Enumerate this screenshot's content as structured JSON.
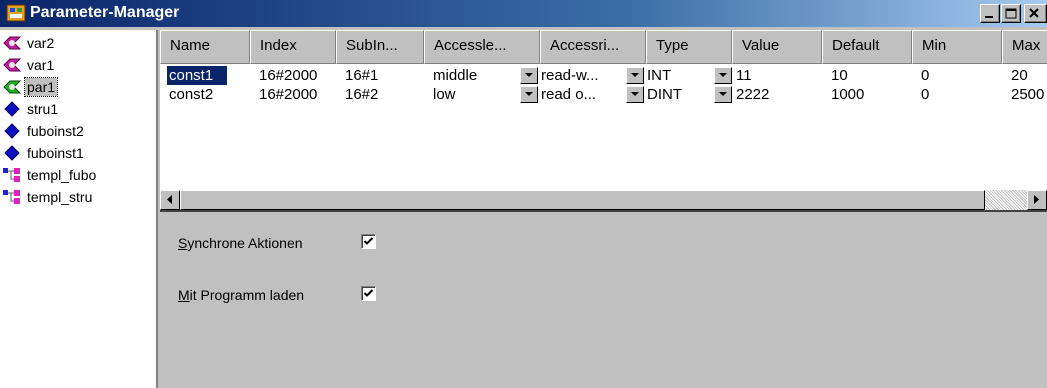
{
  "window": {
    "title": "Parameter-Manager"
  },
  "tree": {
    "items": [
      {
        "label": "var2",
        "icon": "var-icon"
      },
      {
        "label": "var1",
        "icon": "var-icon"
      },
      {
        "label": "par1",
        "icon": "par-icon",
        "selected": true
      },
      {
        "label": "stru1",
        "icon": "diamond-icon"
      },
      {
        "label": "fuboinst2",
        "icon": "diamond-icon"
      },
      {
        "label": "fuboinst1",
        "icon": "diamond-icon"
      },
      {
        "label": "templ_fubo",
        "icon": "template-icon"
      },
      {
        "label": "templ_stru",
        "icon": "template-icon"
      }
    ]
  },
  "table": {
    "columns": [
      "Name",
      "Index",
      "SubIn...",
      "Accessle...",
      "Accessri...",
      "Type",
      "Value",
      "Default",
      "Min",
      "Max"
    ],
    "rows": [
      {
        "name": "const1",
        "index": "16#2000",
        "subindex": "16#1",
        "accesslevel": "middle",
        "accessright": "read-w...",
        "type": "INT",
        "value": "11",
        "default": "10",
        "min": "0",
        "max": "20"
      },
      {
        "name": "const2",
        "index": "16#2000",
        "subindex": "16#2",
        "accesslevel": "low",
        "accessright": "read o...",
        "type": "DINT",
        "value": "2222",
        "default": "1000",
        "min": "0",
        "max": "2500"
      }
    ]
  },
  "properties": {
    "sync_prefix": "S",
    "sync_rest": "ynchrone Aktionen",
    "sync_checked": true,
    "load_prefix": "M",
    "load_rest": "it Programm laden",
    "load_checked": true
  },
  "colors": {
    "selection": "#0a246a",
    "titlebar": "#0a246a",
    "face": "#c0c0c0"
  }
}
